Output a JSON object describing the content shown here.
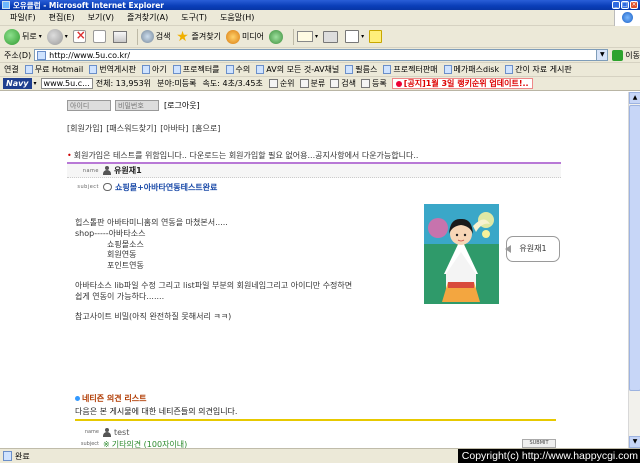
{
  "window": {
    "title": "오유클럽 - Microsoft Internet Explorer"
  },
  "menu": [
    "파일(F)",
    "편집(E)",
    "보기(V)",
    "즐겨찾기(A)",
    "도구(T)",
    "도움말(H)"
  ],
  "toolbar": {
    "back": "뒤로",
    "search": "검색",
    "favorites": "즐겨찾기",
    "media": "미디어"
  },
  "address": {
    "label": "주소(D)",
    "url": "http://www.5u.co.kr/",
    "go": "이동"
  },
  "links": {
    "label": "연결",
    "items": [
      "무료 Hotmail",
      "번역게시판",
      "아기",
      "프로젝터를",
      "수의",
      "AV의 모든 것-AV채널",
      "필름스",
      "프로젝터판매",
      "메가패스disk",
      "간이 자료 게시판"
    ]
  },
  "navy": {
    "logo": "Navy",
    "field1": "www.5u.c...",
    "total": "전체: 13,953위",
    "category": "분야:미등록",
    "speed": "속도: 4초/3.45초",
    "rank": "순위",
    "class": "분류",
    "search": "검색",
    "register": "등록",
    "notice": "[공지]1월 3일 랭키순위 업데이트!.."
  },
  "login": {
    "id_placeholder": "아이디",
    "pw_placeholder": "비밀번호",
    "logout": "[로그아웃]"
  },
  "nav_links": [
    "[회원가입]",
    "[패스워드찾기]",
    "[아바타]",
    "[홈으로]"
  ],
  "post": {
    "intro": "회원가입은 테스트를 위함입니다.. 다운로드는 회원가입할 필요 없어용...공지사항에서 다운가능합니다..",
    "name_key": "name",
    "author": "유원재1",
    "subject_key": "subject",
    "subject": "쇼핑몰+아바타연동테스트완료",
    "body": [
      "힙스톨판 아바타미니홈의 연동을 마쳤본서.....",
      "shop-----아바타소스",
      "쇼핑몰소스",
      "회원연동",
      "포인트연동",
      "",
      "아바타소스 lib파일 수정 그리고 list파일 부분의 회원네임그리고 아이디만 수정하면",
      "쉽게 연동이 가능하다.......",
      "",
      "참고사이트 비밀(아직 완전하질 못해서리 ㅋㅋ)"
    ],
    "bubble": "유원재1"
  },
  "comments": {
    "title": "네티즌 의견 리스트",
    "desc": "다음은 본 게시물에 대한 네티즌들의 의견입니다.",
    "name_key": "name",
    "author": "test",
    "subject_key": "subject",
    "subject_preview": "기타의견 (100자이내)",
    "submit": "SUBMIT"
  },
  "status": {
    "text": "완료"
  },
  "watermark": "Copyright(c) http://www.happycgi.com",
  "colors": {
    "titlebar": "#0a3eb8",
    "chrome": "#ece9d8",
    "purple_rule": "#b879d6",
    "yellow_rule": "#e7c900",
    "subject_blue": "#1a4aa8"
  }
}
